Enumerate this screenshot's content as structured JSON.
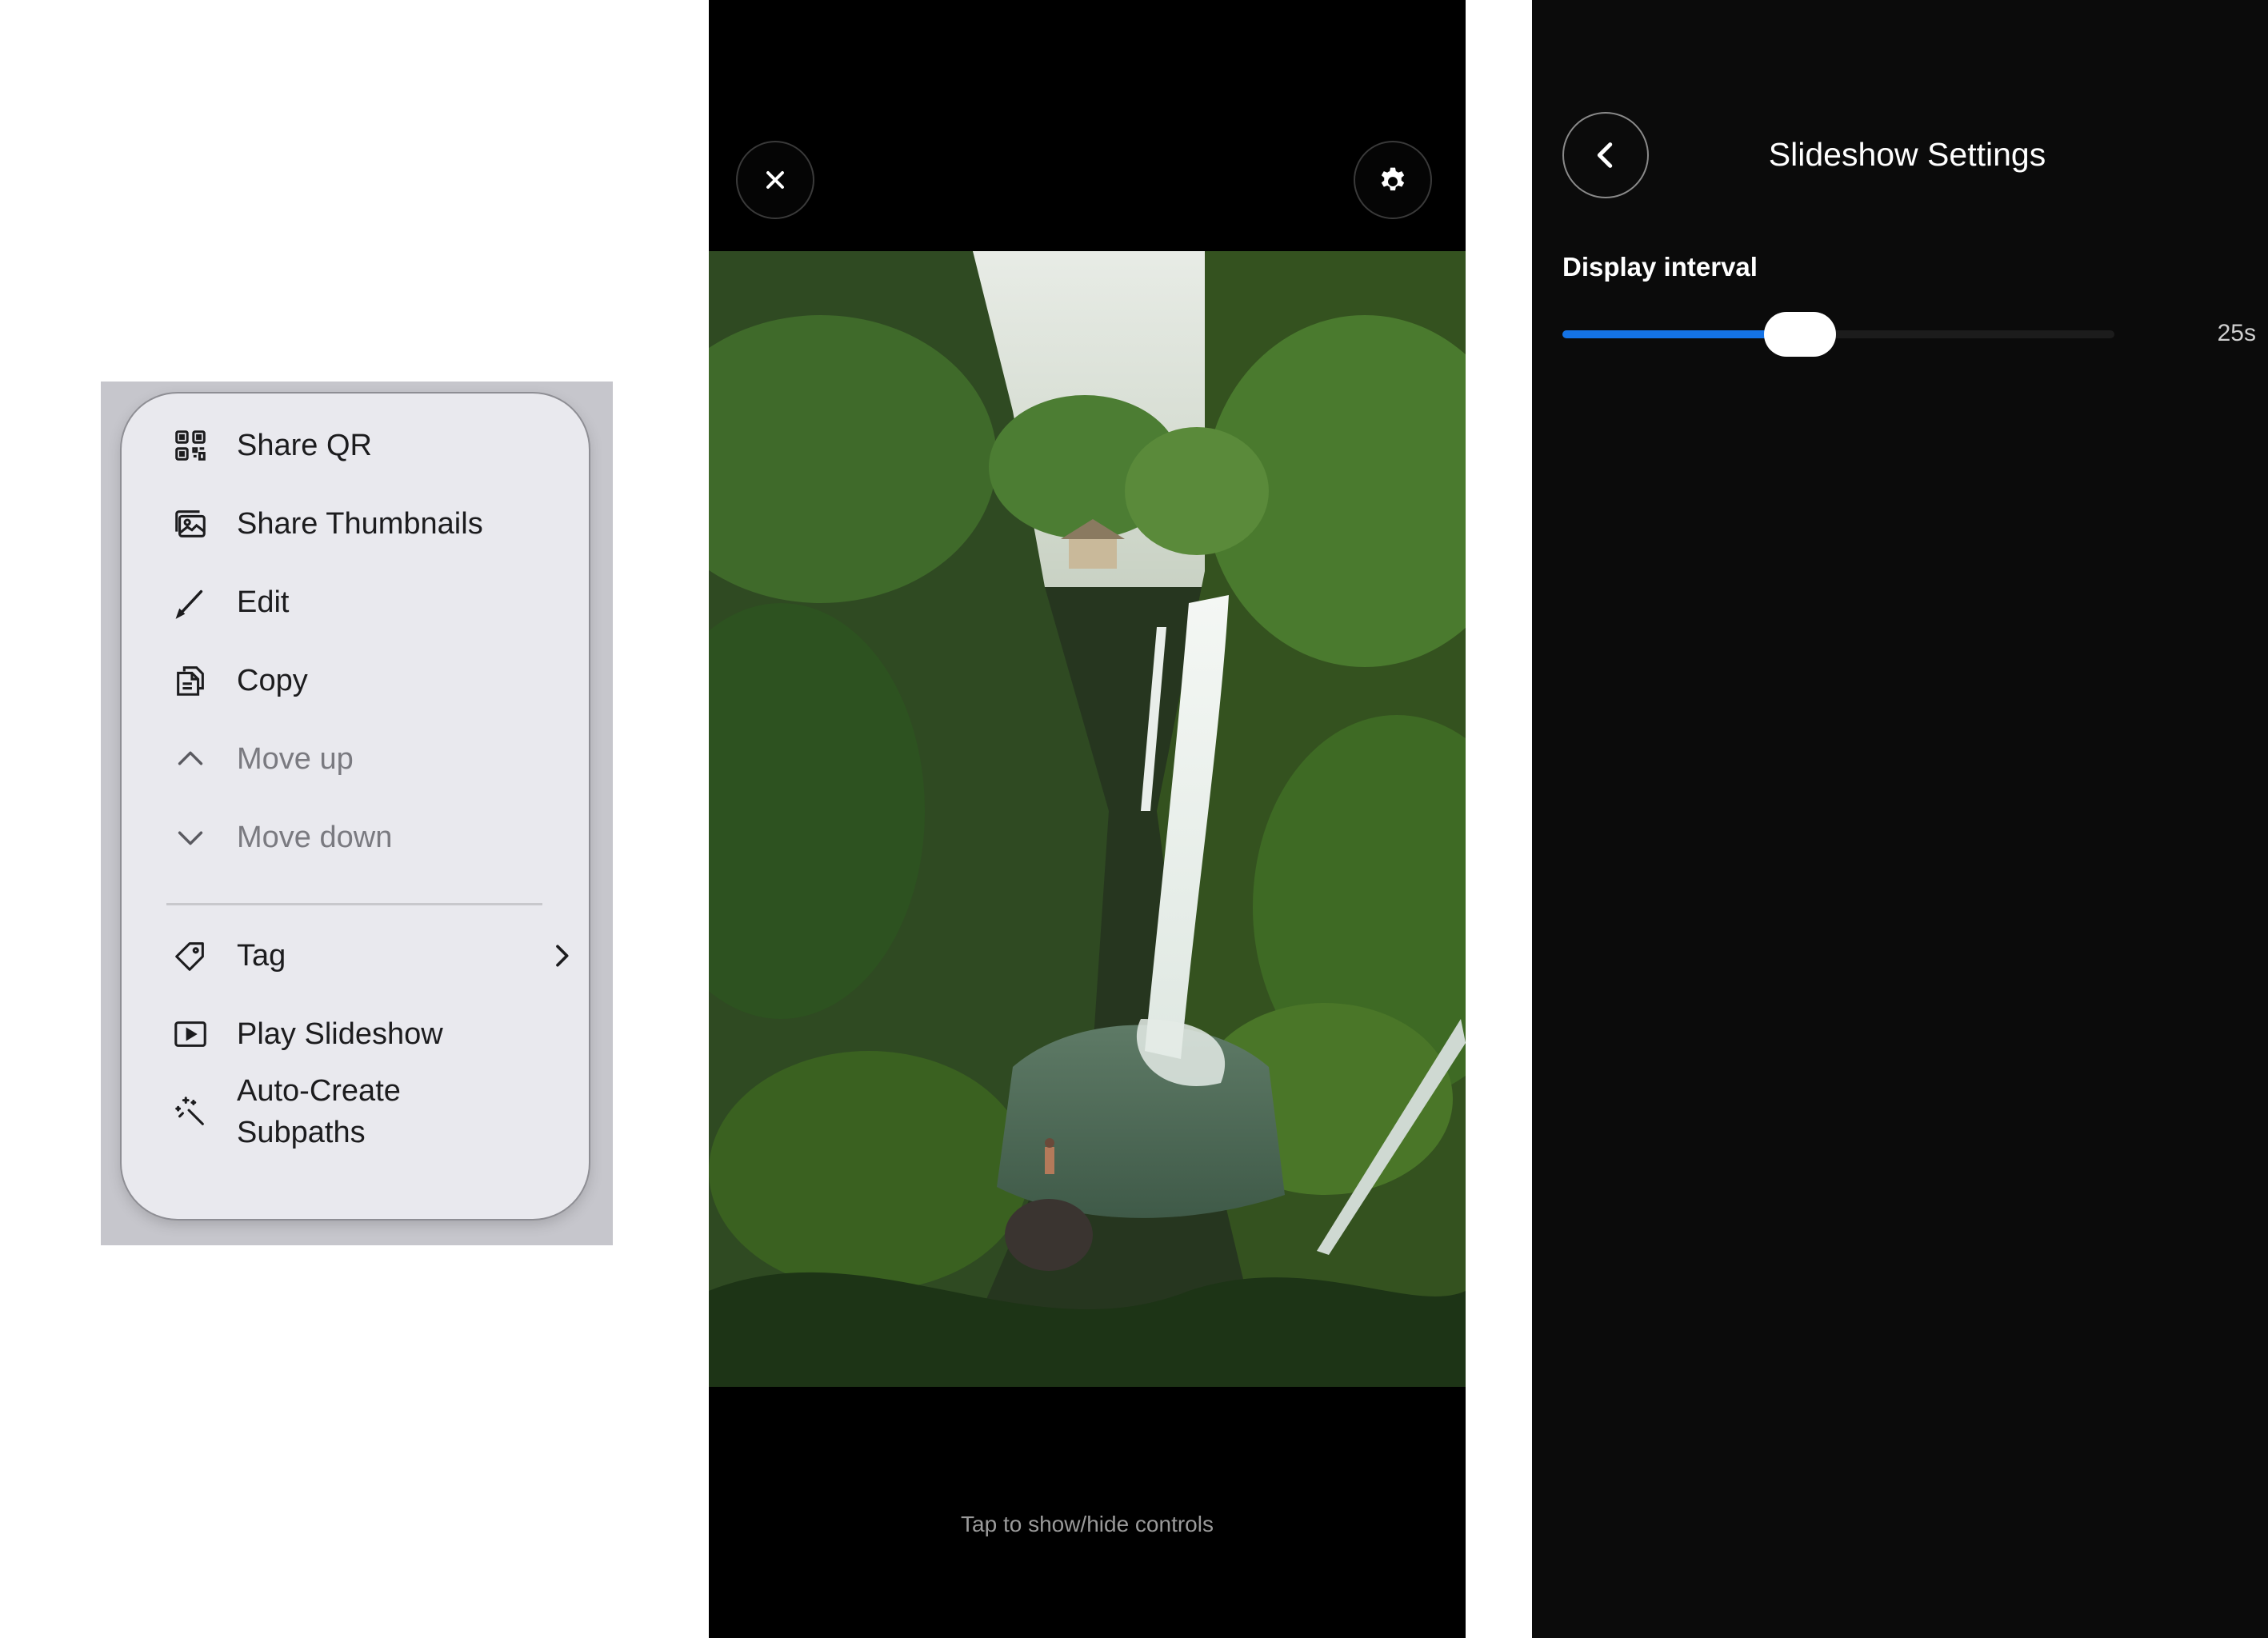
{
  "menu": {
    "items": [
      {
        "label": "Share QR",
        "icon": "qr-code-icon",
        "enabled": true
      },
      {
        "label": "Share Thumbnails",
        "icon": "photos-stack-icon",
        "enabled": true
      },
      {
        "label": "Edit",
        "icon": "pencil-icon",
        "enabled": true
      },
      {
        "label": "Copy",
        "icon": "copy-icon",
        "enabled": true
      },
      {
        "label": "Move up",
        "icon": "chevron-up-icon",
        "enabled": false
      },
      {
        "label": "Move down",
        "icon": "chevron-down-icon",
        "enabled": false
      },
      {
        "label": "Tag",
        "icon": "tag-icon",
        "enabled": true,
        "has_submenu": true
      },
      {
        "label": "Play Slideshow",
        "icon": "play-rectangle-icon",
        "enabled": true
      },
      {
        "label": "Auto-Create\nSubpaths",
        "icon": "magic-wand-icon",
        "enabled": true
      }
    ]
  },
  "viewer": {
    "close_icon": "close-icon",
    "settings_icon": "gear-icon",
    "hint": "Tap to show/hide controls"
  },
  "settings": {
    "title": "Slideshow Settings",
    "back_icon": "chevron-left-icon",
    "interval_label": "Display interval",
    "interval_value": "25s",
    "interval_fraction": 0.43,
    "accent_color": "#1473e6"
  }
}
